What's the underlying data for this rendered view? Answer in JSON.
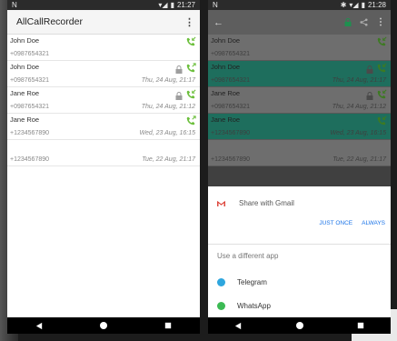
{
  "left_phone": {
    "status": {
      "left_icon": "N",
      "time": "21:27"
    },
    "app_title": "AllCallRecorder",
    "calls": [
      {
        "name": "John Doe",
        "number": "+0987654321",
        "date": "",
        "locked": false,
        "direction": "incoming"
      },
      {
        "name": "John Doe",
        "number": "+0987654321",
        "date": "Thu, 24 Aug, 21:17",
        "locked": true,
        "direction": "outgoing"
      },
      {
        "name": "Jane Roe",
        "number": "+0987654321",
        "date": "Thu, 24 Aug, 21:12",
        "locked": true,
        "direction": "incoming"
      },
      {
        "name": "Jane Roe",
        "number": "+1234567890",
        "date": "Wed, 23 Aug, 16:15",
        "locked": false,
        "direction": "outgoing"
      },
      {
        "name": "",
        "number": "+1234567890",
        "date": "Tue, 22 Aug, 21:17",
        "locked": false,
        "direction": "none"
      }
    ]
  },
  "right_phone": {
    "status": {
      "left_icon": "N",
      "time": "21:28"
    },
    "calls": [
      {
        "name": "John Doe",
        "number": "+0987654321",
        "date": "",
        "selected": false
      },
      {
        "name": "John Doe",
        "number": "+0987654321",
        "date": "Thu, 24 Aug, 21:17",
        "selected": true
      },
      {
        "name": "Jane Roe",
        "number": "+0987654321",
        "date": "Thu, 24 Aug, 21:12",
        "selected": false
      },
      {
        "name": "Jane Roe",
        "number": "+1234567890",
        "date": "Wed, 23 Aug, 16:15",
        "selected": true
      },
      {
        "name": "",
        "number": "+1234567890",
        "date": "Tue, 22 Aug, 21:17",
        "selected": false
      }
    ],
    "sheet": {
      "share_with": "Share with Gmail",
      "just_once": "JUST ONCE",
      "always": "ALWAYS",
      "use_different": "Use a different app",
      "apps": [
        {
          "name": "Telegram",
          "icon": "telegram-icon",
          "color": "#2ea6de"
        },
        {
          "name": "WhatsApp",
          "icon": "whatsapp-icon",
          "color": "#3cba54"
        }
      ]
    }
  },
  "colors": {
    "accent": "#1e6e5d",
    "call_icon": "#6cbf3c",
    "link": "#1a73e8",
    "gmail_red": "#d93025"
  }
}
